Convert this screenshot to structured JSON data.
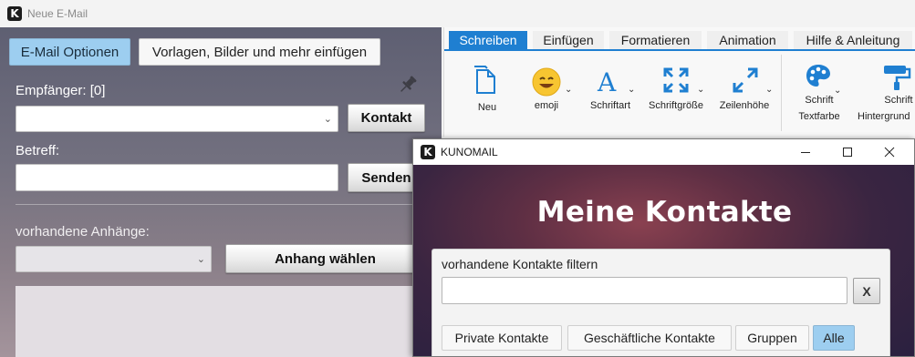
{
  "window": {
    "title": "Neue E-Mail",
    "logo_letter": "K"
  },
  "left": {
    "tabs": [
      {
        "label": "E-Mail Optionen",
        "active": true
      },
      {
        "label": "Vorlagen, Bilder und mehr einfügen",
        "active": false
      }
    ],
    "recipients_label": "Empfänger:",
    "recipients_count": "[0]",
    "recipient_value": "",
    "contact_button": "Kontakt",
    "subject_label": "Betreff:",
    "subject_value": "",
    "send_button": "Senden",
    "attachments_label": "vorhandene Anhänge:",
    "attachment_value": "",
    "attach_button": "Anhang wählen"
  },
  "ribbon": {
    "tabs": [
      {
        "label": "Schreiben",
        "active": true
      },
      {
        "label": "Einfügen",
        "active": false
      },
      {
        "label": "Formatieren",
        "active": false
      },
      {
        "label": "Animation",
        "active": false
      },
      {
        "label": "Hilfe & Anleitung",
        "active": false
      }
    ],
    "items": [
      {
        "label": "Neu",
        "icon": "new-document-icon"
      },
      {
        "label": "emoji",
        "icon": "emoji-icon"
      },
      {
        "label": "Schriftart",
        "icon": "font-icon"
      },
      {
        "label": "Schriftgröße",
        "icon": "font-size-icon"
      },
      {
        "label": "Zeilenhöhe",
        "icon": "line-height-icon"
      },
      {
        "label_line1": "Schrift",
        "label_line2": "Textfarbe",
        "icon": "palette-icon"
      },
      {
        "label_line1": "Schrift",
        "label_line2": "Hintergrund",
        "icon": "paint-roller-icon"
      }
    ],
    "accent_color": "#1f7fd1"
  },
  "dialog": {
    "title": "KUNOMAIL",
    "logo_letter": "K",
    "heading": "Meine Kontakte",
    "filter_label": "vorhandene Kontakte filtern",
    "filter_value": "",
    "clear_button": "X",
    "filter_tabs": [
      {
        "label": "Private Kontakte",
        "active": false
      },
      {
        "label": "Geschäftliche Kontakte",
        "active": false
      },
      {
        "label": "Gruppen",
        "active": false
      },
      {
        "label": "Alle",
        "active": true
      }
    ],
    "controls": {
      "minimize": "minimize-icon",
      "maximize": "maximize-icon",
      "close": "close-icon"
    }
  }
}
